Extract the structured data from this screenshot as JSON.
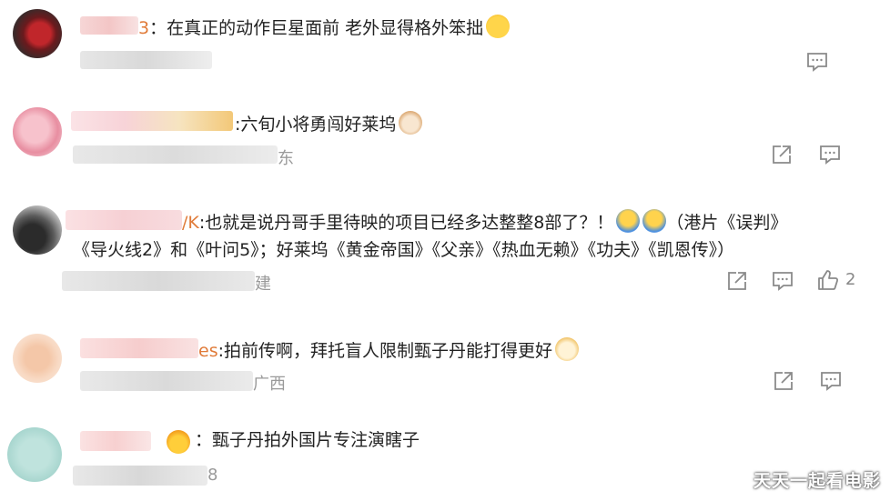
{
  "comments": [
    {
      "name_tail": "3",
      "text": "：在真正的动作巨星面前 老外显得格外笨拙",
      "meta_tail": "",
      "likes": ""
    },
    {
      "name_tail": "",
      "text": ":六旬小将勇闯好莱坞",
      "meta_tail": "东",
      "likes": ""
    },
    {
      "name_tail": "/K",
      "text": ":也就是说丹哥手里待映的项目已经多达整整8部了？！",
      "text_cont": "（港片《误判》",
      "text_line2": "《导火线2》和《叶问5》；好莱坞《黄金帝国》《父亲》《热血无赖》《功夫》《凯恩传》）",
      "meta_tail": "建",
      "likes": "2"
    },
    {
      "name_tail": "es",
      "text": ":拍前传啊，拜托盲人限制甄子丹能打得更好",
      "meta_tail": "广西",
      "likes": ""
    },
    {
      "name_tail": "",
      "text": "：甄子丹拍外国片专注演瞎子",
      "meta_tail": "8",
      "likes": ""
    }
  ],
  "watermark": "天天一起看电影",
  "colors": {
    "accent": "#e07b39",
    "meta": "#9a9a9a",
    "icon": "#8a8a8a"
  }
}
